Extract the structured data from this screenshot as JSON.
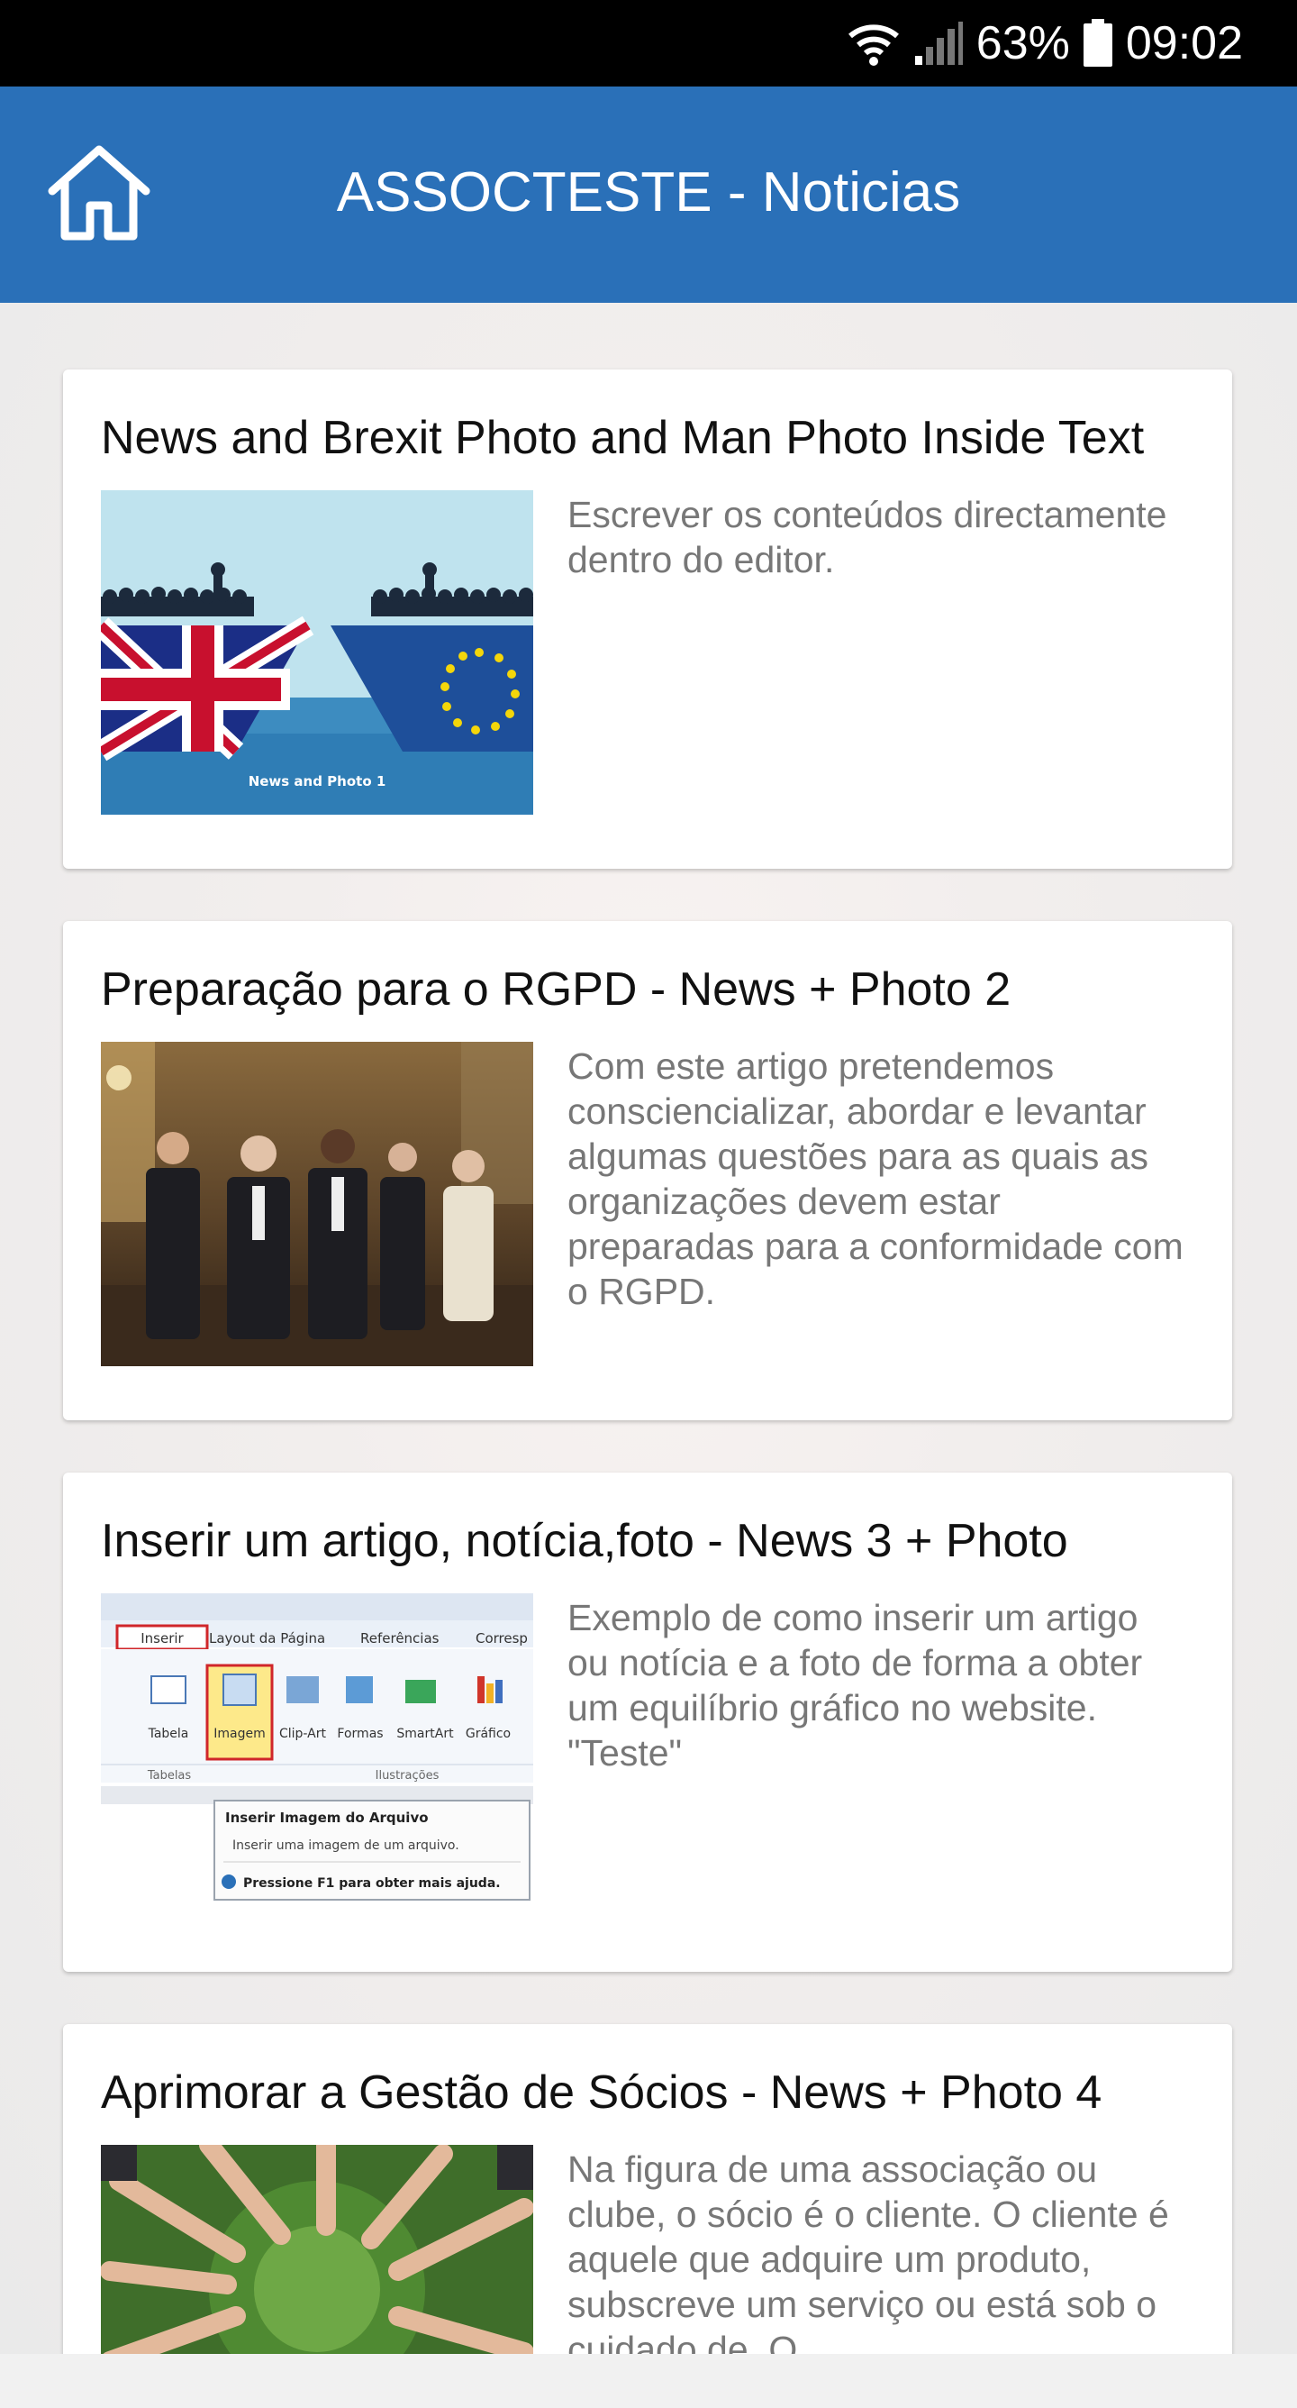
{
  "status_bar": {
    "battery": "63%",
    "time": "09:02",
    "icons": [
      "wifi-icon",
      "signal-icon",
      "battery-icon"
    ]
  },
  "app_bar": {
    "title": "ASSOCTESTE - Noticias",
    "home_icon": "home-icon",
    "color": "#2a70b8"
  },
  "news": [
    {
      "title": "News and Brexit Photo and Man Photo Inside Text",
      "excerpt": "Escrever os conteúdos directamente dentro do editor.",
      "image_caption": "News and Photo 1"
    },
    {
      "title": "Preparação para o RGPD - News + Photo 2",
      "excerpt": "Com este artigo pretendemos consciencializar, abordar e levantar algumas questões para as quais as organizações devem estar preparadas para a conformidade com o RGPD."
    },
    {
      "title": "Inserir um artigo, notícia,foto - News 3 + Photo",
      "excerpt": "Exemplo de como inserir um artigo ou notícia e a foto de forma a obter um equilíbrio gráfico no website. \"Teste\"",
      "screenshot": {
        "tabs": [
          "Inserir",
          "Layout da Página",
          "Referências",
          "Corresp"
        ],
        "buttons": [
          "Tabela",
          "Imagem",
          "Clip-Art",
          "Formas",
          "SmartArt",
          "Gráfico"
        ],
        "groups": [
          "Tabelas",
          "Ilustrações"
        ],
        "tooltip_title": "Inserir Imagem do Arquivo",
        "tooltip_desc": "Inserir uma imagem de um arquivo.",
        "tooltip_help": "Pressione F1 para obter mais ajuda."
      }
    },
    {
      "title": "Aprimorar a Gestão de Sócios - News + Photo 4",
      "excerpt": "Na figura de uma associação ou clube, o sócio é o cliente. O cliente é aquele que adquire um produto, subscreve um serviço ou está sob o cuidado de. O"
    }
  ]
}
